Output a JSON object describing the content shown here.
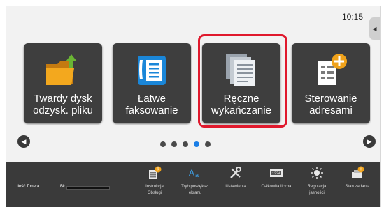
{
  "status_bar": {
    "time": "10:15"
  },
  "tiles": [
    {
      "label_line1": "Twardy dysk",
      "label_line2": "odzysk. pliku",
      "icon": "folder-upload-icon"
    },
    {
      "label_line1": "Łatwe",
      "label_line2": "faksowanie",
      "icon": "fax-phone-icon"
    },
    {
      "label_line1": "Ręczne",
      "label_line2": "wykańczanie",
      "icon": "stacked-documents-icon",
      "selected": true
    },
    {
      "label_line1": "Sterowanie",
      "label_line2": "adresami",
      "icon": "address-add-icon"
    }
  ],
  "pagination": {
    "pages": 5,
    "active": 4
  },
  "bottom_bar": {
    "toner_label": "Ilość Tonera",
    "toner_color_label": "Bk",
    "toner_level": 1.0,
    "items": [
      {
        "label": "Instrukcja Obsługi",
        "icon": "manual-icon"
      },
      {
        "label": "Tryb powiększ. ekranu",
        "icon": "zoom-text-icon"
      },
      {
        "label": "Ustawienia",
        "icon": "tools-icon"
      },
      {
        "label": "Całkowita liczba",
        "icon": "counter-icon"
      },
      {
        "label": "Regulacja jasności",
        "icon": "brightness-icon"
      },
      {
        "label": "Stan zadania",
        "icon": "job-status-icon"
      }
    ]
  },
  "colors": {
    "tile_bg": "#3e3e3e",
    "highlight": "#e0192d",
    "active_dot": "#1a7ee6",
    "accent_orange": "#f0a21a",
    "accent_blue": "#1a86d8"
  }
}
